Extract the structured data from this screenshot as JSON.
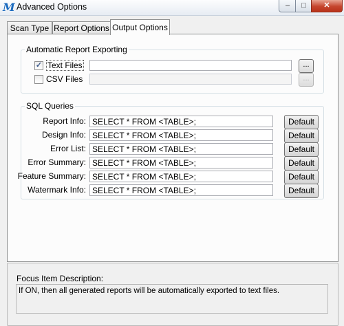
{
  "window": {
    "title": "Advanced Options",
    "close_glyph": "✕",
    "min_glyph": "–",
    "max_glyph": "□",
    "icon": "app-logo-icon"
  },
  "tabs": [
    {
      "label": "Scan Type"
    },
    {
      "label": "Report Options"
    },
    {
      "label": "Output Options",
      "selected": true
    }
  ],
  "export_group": {
    "title": "Automatic Report Exporting",
    "text_files": {
      "label": "Text Files",
      "checked": true,
      "value": ""
    },
    "csv_files": {
      "label": "CSV Files",
      "checked": false,
      "value": ""
    },
    "browse_label": "..."
  },
  "sql_group": {
    "title": "SQL Queries",
    "default_label": "Default",
    "rows": [
      {
        "label": "Report Info:",
        "query": "SELECT * FROM <TABLE>;"
      },
      {
        "label": "Design Info:",
        "query": "SELECT * FROM <TABLE>;"
      },
      {
        "label": "Error List:",
        "query": "SELECT * FROM <TABLE>;"
      },
      {
        "label": "Error Summary:",
        "query": "SELECT * FROM <TABLE>;"
      },
      {
        "label": "Feature Summary:",
        "query": "SELECT * FROM <TABLE>;"
      },
      {
        "label": "Watermark Info:",
        "query": "SELECT * FROM <TABLE>;"
      }
    ]
  },
  "focus": {
    "title": "Focus Item Description:",
    "text": "If ON, then all generated reports will be automatically exported to text files."
  },
  "colors": {
    "accent": "#1c6bbf",
    "close": "#c5462e"
  }
}
